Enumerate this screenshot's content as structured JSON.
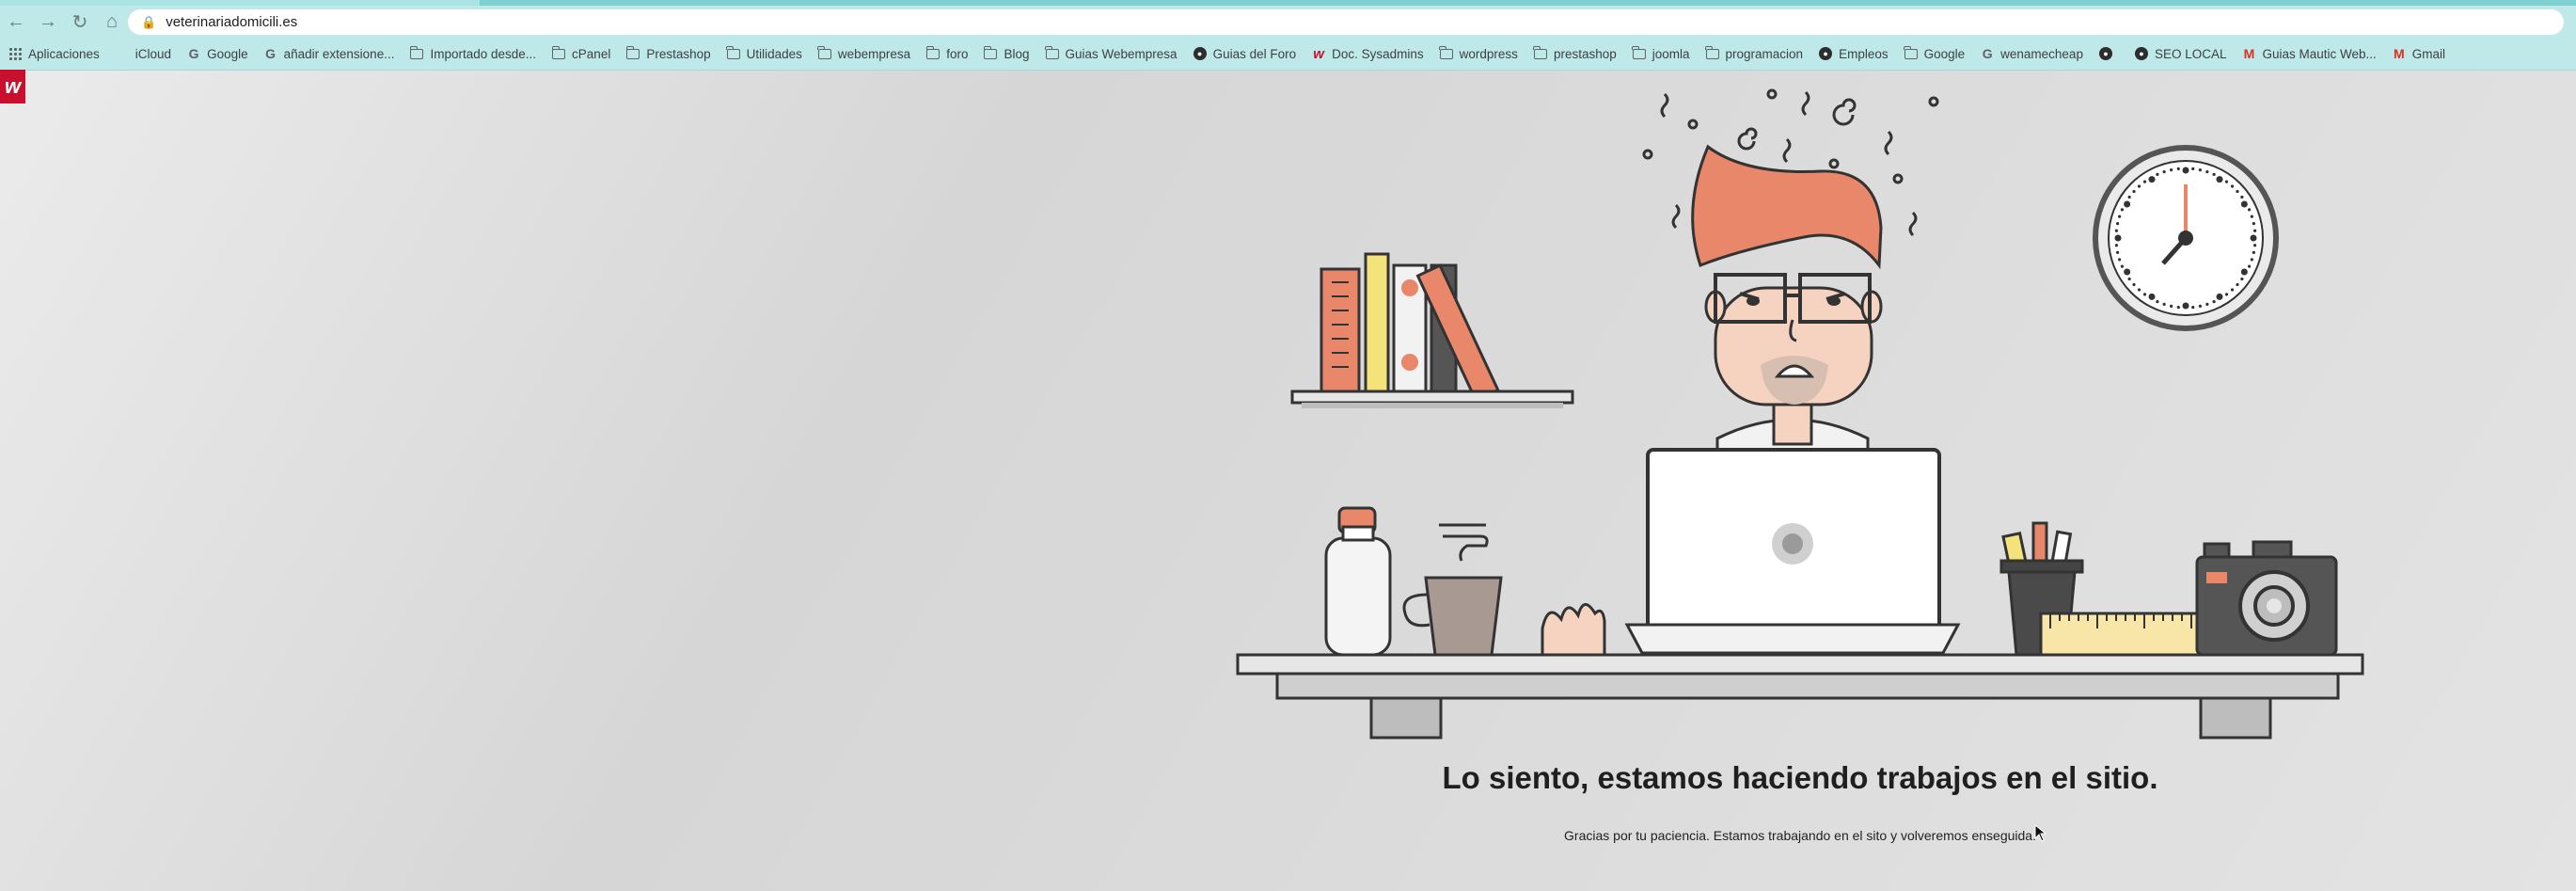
{
  "browser": {
    "url": "veterinariadomicili.es",
    "nav": {
      "back_icon": "arrow-left-icon",
      "forward_icon": "arrow-right-icon",
      "reload_icon": "reload-icon",
      "home_icon": "home-icon"
    },
    "bookmarks": [
      {
        "label": "Aplicaciones",
        "icon": "apps-icon"
      },
      {
        "label": "iCloud",
        "icon": "apple-icon"
      },
      {
        "label": "Google",
        "icon": "google-icon"
      },
      {
        "label": "añadir extensione...",
        "icon": "google-icon"
      },
      {
        "label": "Importado desde...",
        "icon": "folder-icon"
      },
      {
        "label": "cPanel",
        "icon": "folder-icon"
      },
      {
        "label": "Prestashop",
        "icon": "folder-icon"
      },
      {
        "label": "Utilidades",
        "icon": "folder-icon"
      },
      {
        "label": "webempresa",
        "icon": "folder-icon"
      },
      {
        "label": "foro",
        "icon": "folder-icon"
      },
      {
        "label": "Blog",
        "icon": "folder-icon"
      },
      {
        "label": "Guias Webempresa",
        "icon": "folder-icon"
      },
      {
        "label": "Guias del Foro",
        "icon": "forum-icon"
      },
      {
        "label": "Doc. Sysadmins",
        "icon": "webempresa-icon"
      },
      {
        "label": "wordpress",
        "icon": "folder-icon"
      },
      {
        "label": "prestashop",
        "icon": "folder-icon"
      },
      {
        "label": "joomla",
        "icon": "folder-icon"
      },
      {
        "label": "programacion",
        "icon": "folder-icon"
      },
      {
        "label": "Empleos",
        "icon": "globe-icon"
      },
      {
        "label": "Google",
        "icon": "folder-icon"
      },
      {
        "label": "wenamecheap",
        "icon": "google-icon"
      },
      {
        "label": "",
        "icon": "globe-icon"
      },
      {
        "label": "SEO LOCAL",
        "icon": "seo-icon"
      },
      {
        "label": "Guias Mautic Web...",
        "icon": "mautic-icon"
      },
      {
        "label": "Gmail",
        "icon": "gmail-icon"
      }
    ]
  },
  "page": {
    "logo_letter": "w",
    "headline": "Lo siento, estamos haciendo trabajos en el sitio.",
    "subline": "Gracias por tu paciencia. Estamos trabajando en el sito y volveremos enseguida."
  },
  "colors": {
    "accent_red": "#c8102e",
    "toolbar": "#bfe9e9",
    "hair": "#e8876a",
    "skin": "#f6d3c0"
  }
}
